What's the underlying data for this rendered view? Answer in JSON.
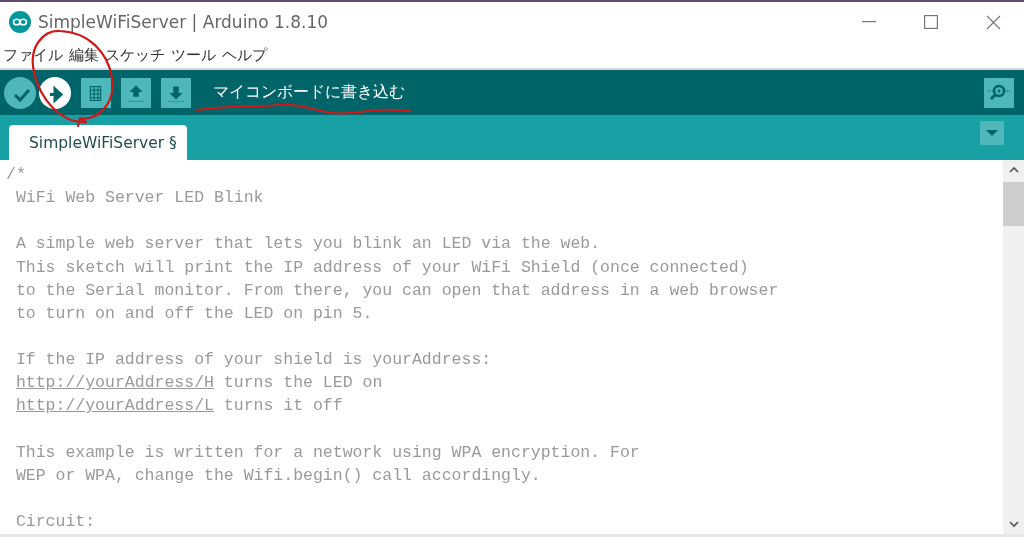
{
  "window": {
    "title": "SimpleWiFiServer | Arduino 1.8.10"
  },
  "menu": [
    "ファイル",
    "編集",
    "スケッチ",
    "ツール",
    "ヘルプ"
  ],
  "toolbar": {
    "buttons": [
      {
        "kind": "verify",
        "highlighted": false
      },
      {
        "kind": "upload",
        "highlighted": true
      },
      {
        "kind": "new",
        "highlighted": false
      },
      {
        "kind": "open",
        "highlighted": false
      },
      {
        "kind": "save",
        "highlighted": false
      }
    ],
    "hint": "マイコンボードに書き込む"
  },
  "tabs": [
    {
      "label": "SimpleWiFiServer §",
      "selected": true
    }
  ],
  "editor": {
    "paragraphs": [
      [
        {
          "kind": "text",
          "text": "/*"
        },
        {
          "kind": "text",
          "text": " WiFi Web Server LED Blink"
        }
      ],
      [
        {
          "kind": "text",
          "text": " A simple web server that lets you blink an LED via the web."
        },
        {
          "kind": "text",
          "text": " This sketch will print the IP address of your WiFi Shield (once connected)"
        },
        {
          "kind": "text",
          "text": " to the Serial monitor. From there, you can open that address in a web browser"
        },
        {
          "kind": "text",
          "text": " to turn on and off the LED on pin 5."
        }
      ],
      [
        {
          "kind": "text",
          "text": " If the IP address of your shield is yourAddress:"
        },
        {
          "kind": "link",
          "link": "http://yourAddress/H",
          "text": " turns the LED on"
        },
        {
          "kind": "link",
          "link": "http://yourAddress/L",
          "text": " turns it off"
        }
      ],
      [
        {
          "kind": "text",
          "text": " This example is written for a network using WPA encryption. For"
        },
        {
          "kind": "text",
          "text": " WEP or WPA, change the Wifi.begin() call accordingly."
        }
      ],
      [
        {
          "kind": "text",
          "text": " Circuit:"
        }
      ]
    ]
  }
}
